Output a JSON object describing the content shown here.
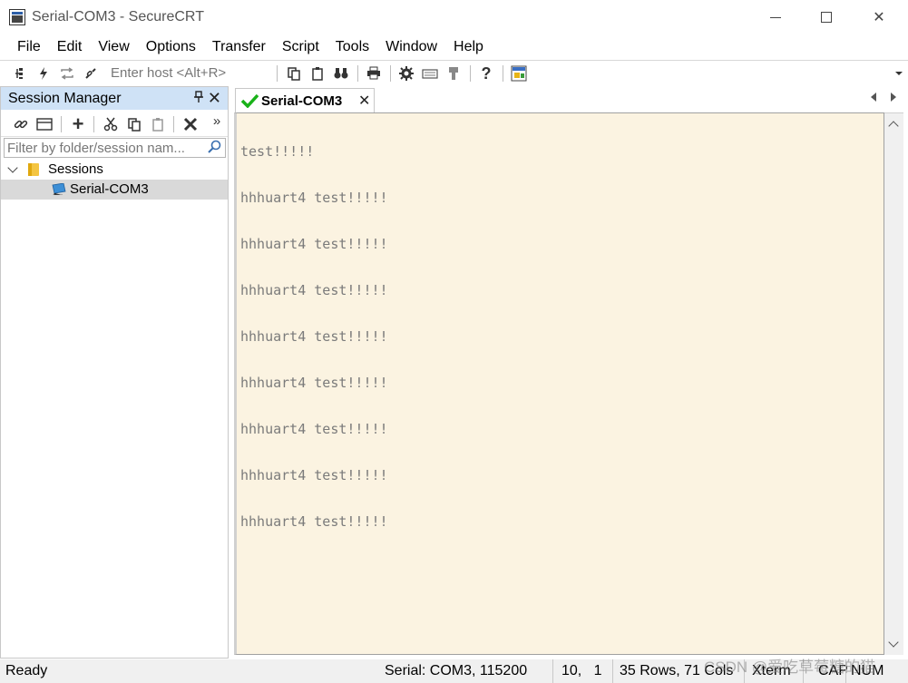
{
  "window": {
    "title": "Serial-COM3 - SecureCRT",
    "minimize_glyph": "minimize",
    "maximize_glyph": "maximize",
    "close_glyph": "✕"
  },
  "menu": [
    "File",
    "Edit",
    "View",
    "Options",
    "Transfer",
    "Script",
    "Tools",
    "Window",
    "Help"
  ],
  "toolbar": {
    "host_placeholder": "Enter host <Alt+R>",
    "icons": [
      "connect-icon",
      "quick-connect-icon",
      "reconnect-icon",
      "disconnect-icon",
      "copy-icon",
      "paste-icon",
      "find-icon",
      "print-icon",
      "settings-icon",
      "keymap-icon",
      "sftp-icon",
      "help-icon",
      "app-screenshot-icon"
    ]
  },
  "session_manager": {
    "title": "Session Manager",
    "pin_glyph": "⍠",
    "close_glyph": "✕",
    "more_glyph": "»",
    "filter_placeholder": "Filter by folder/session nam...",
    "tree": [
      {
        "label": "Sessions",
        "type": "folder",
        "expanded": true
      },
      {
        "label": "Serial-COM3",
        "type": "session",
        "selected": true
      }
    ]
  },
  "tab": {
    "label": "Serial-COM3",
    "close_glyph": "✕",
    "status": "connected"
  },
  "terminal": {
    "lines": [
      "test!!!!!",
      "hhhuart4 test!!!!!",
      "hhhuart4 test!!!!!",
      "hhhuart4 test!!!!!",
      "hhhuart4 test!!!!!",
      "hhhuart4 test!!!!!",
      "hhhuart4 test!!!!!",
      "hhhuart4 test!!!!!",
      "hhhuart4 test!!!!!"
    ],
    "background": "#fbf3e1",
    "foreground": "#7b7b7b"
  },
  "status": {
    "ready": "Ready",
    "connection": "Serial: COM3, 115200",
    "cursor": "10,   1",
    "size": "35 Rows, 71 Cols",
    "terminal_type": "Xterm",
    "caps": "CAP",
    "num": "NUM"
  },
  "watermark": "CSDN @爱吃草莓糖的猫"
}
